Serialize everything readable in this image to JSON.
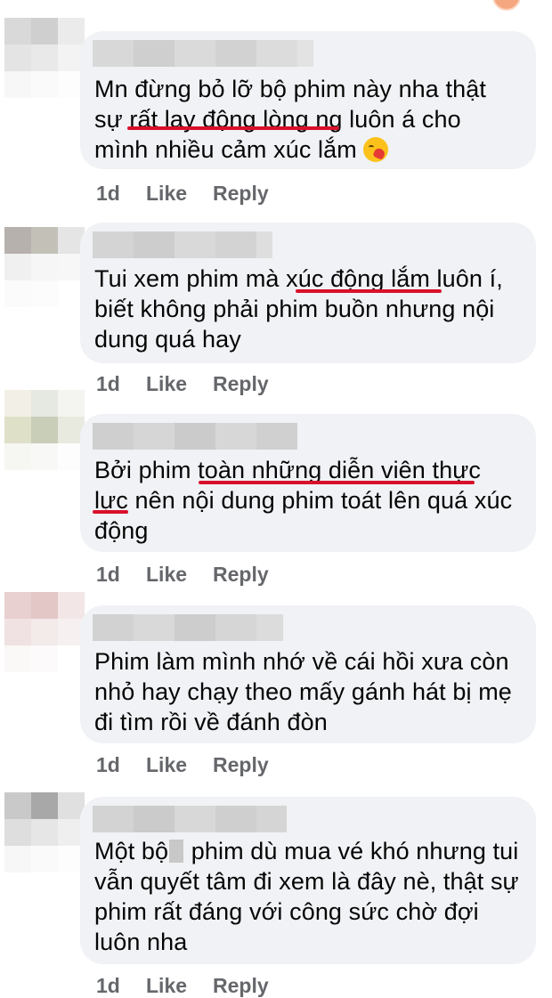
{
  "comments": [
    {
      "lines": [
        "Mn đừng bỏ lỡ bộ phim này nha thật",
        "sự rất lay động lòng ng luôn á cho",
        "mình nhiều cảm xúc lắm"
      ],
      "emoji": "kissing-heart-emoji",
      "time": "1d",
      "like": "Like",
      "reply": "Reply"
    },
    {
      "lines": [
        "Tui xem phim mà xúc động lắm luôn í,",
        "biết không phải phim buồn nhưng nội",
        "dung quá hay"
      ],
      "time": "1d",
      "like": "Like",
      "reply": "Reply"
    },
    {
      "lines": [
        "Bởi phim toàn những diễn viên thực",
        "lực nên nội dung phim toát lên quá xúc",
        "động"
      ],
      "time": "1d",
      "like": "Like",
      "reply": "Reply"
    },
    {
      "lines": [
        "Phim làm mình nhớ về cái hồi xưa còn",
        "nhỏ hay chạy theo mấy gánh hát bị mẹ",
        "đi tìm rồi về đánh đòn"
      ],
      "time": "1d",
      "like": "Like",
      "reply": "Reply"
    },
    {
      "lines": [
        "Một bộ",
        "phim dù mua vé khó nhưng tui",
        "vẫn quyết tâm đi xem là đây nè, thật sự",
        "phim rất đáng với công sức chờ đợi",
        "luôn nha"
      ],
      "time": "1d",
      "like": "Like",
      "reply": "Reply"
    }
  ],
  "colors": {
    "bubble": "#f0f2f5",
    "text": "#050505",
    "meta": "#65676b",
    "underline": "#d9102a"
  }
}
